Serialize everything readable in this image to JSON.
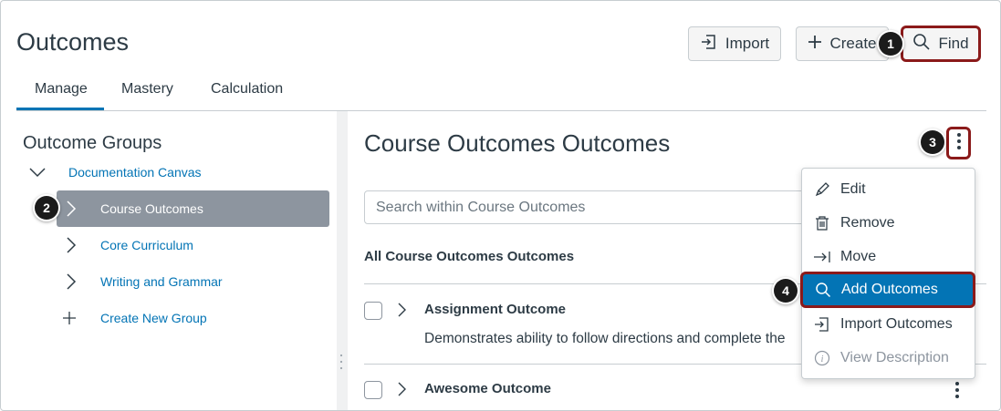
{
  "header": {
    "title": "Outcomes",
    "import_label": "Import",
    "create_label": "Create",
    "find_label": "Find"
  },
  "tabs": [
    {
      "label": "Manage",
      "active": true
    },
    {
      "label": "Mastery",
      "active": false
    },
    {
      "label": "Calculation",
      "active": false
    }
  ],
  "sidebar": {
    "title": "Outcome Groups",
    "items": [
      {
        "label": "Documentation Canvas",
        "expanded": true
      },
      {
        "label": "Course Outcomes",
        "selected": true
      },
      {
        "label": "Core Curriculum"
      },
      {
        "label": "Writing and Grammar"
      },
      {
        "label": "Create New Group"
      }
    ]
  },
  "main": {
    "title": "Course Outcomes Outcomes",
    "search_placeholder": "Search within Course Outcomes",
    "list_heading": "All Course Outcomes Outcomes",
    "outcomes": [
      {
        "title": "Assignment Outcome",
        "description": "Demonstrates ability to follow directions and complete the"
      },
      {
        "title": "Awesome Outcome",
        "description": ""
      }
    ]
  },
  "menu": {
    "items": [
      {
        "label": "Edit",
        "icon": "pencil-icon"
      },
      {
        "label": "Remove",
        "icon": "trash-icon"
      },
      {
        "label": "Move",
        "icon": "move-arrow-icon"
      },
      {
        "label": "Add Outcomes",
        "icon": "search-icon",
        "highlighted": true
      },
      {
        "label": "Import Outcomes",
        "icon": "import-icon"
      },
      {
        "label": "View Description",
        "icon": "info-icon",
        "disabled": true
      }
    ]
  },
  "callouts": [
    "1",
    "2",
    "3",
    "4"
  ],
  "colors": {
    "link_blue": "#0374b5",
    "callout_red": "#8b1a1a",
    "selected_gray": "#8d959f",
    "text": "#2d3b45"
  }
}
